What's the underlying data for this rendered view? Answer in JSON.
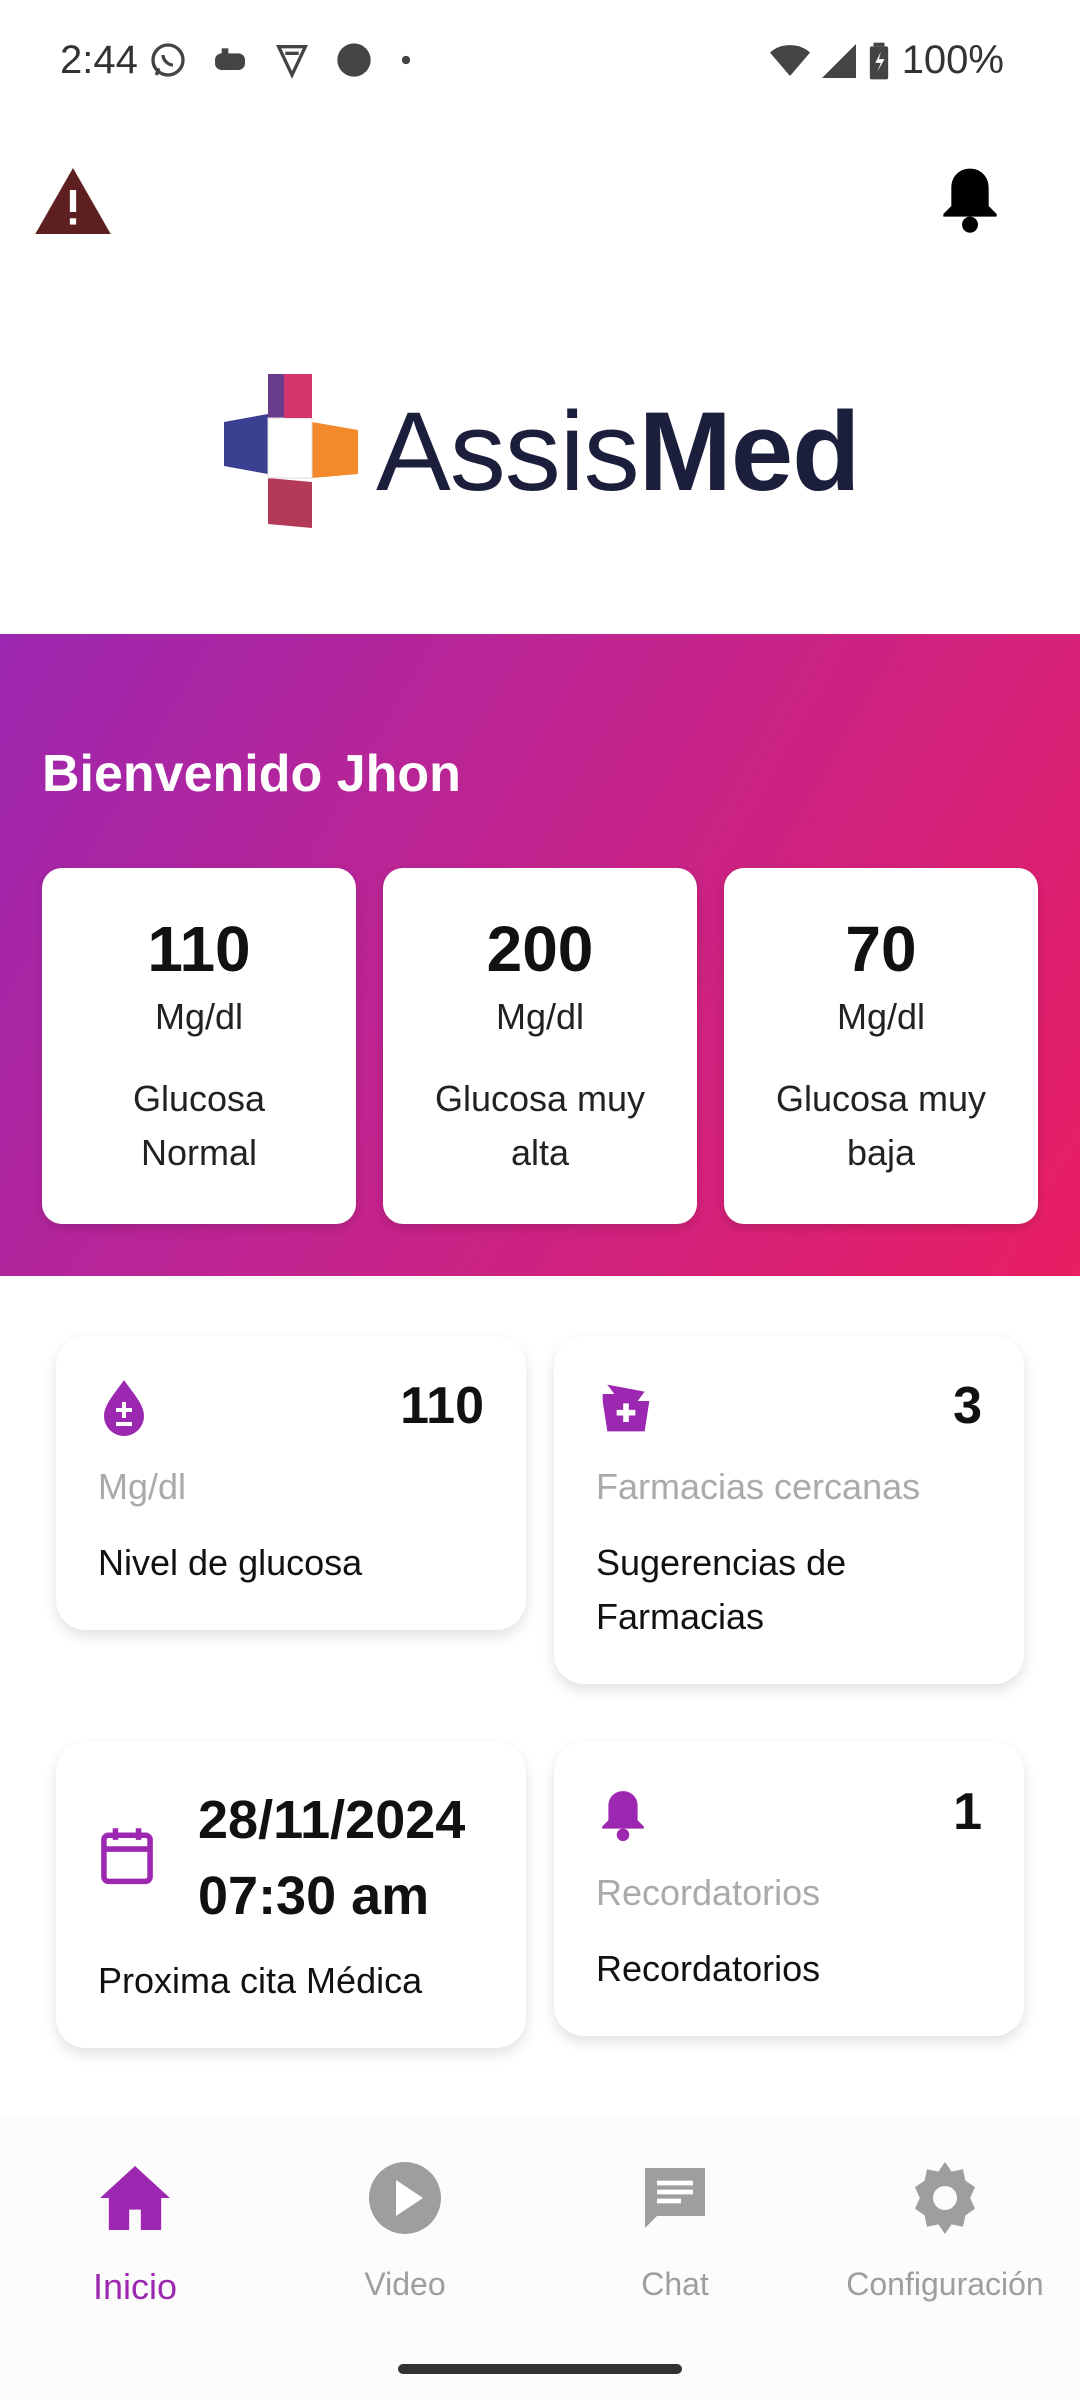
{
  "status_bar": {
    "time": "2:44",
    "battery": "100%"
  },
  "brand": {
    "name_light": "Assis",
    "name_bold": "Med",
    "accent": "#9c27b0",
    "gradient_end": "#e91e63"
  },
  "hero": {
    "welcome": "Bienvenido Jhon",
    "cards": [
      {
        "value": "110",
        "unit": "Mg/dl",
        "label": "Glucosa Normal"
      },
      {
        "value": "200",
        "unit": "Mg/dl",
        "label": "Glucosa muy alta"
      },
      {
        "value": "70",
        "unit": "Mg/dl",
        "label": "Glucosa muy baja"
      }
    ]
  },
  "cards": {
    "glucose": {
      "icon": "glucose-drop-icon",
      "value": "110",
      "sub": "Mg/dl",
      "label": "Nivel de glucosa"
    },
    "pharmacies": {
      "icon": "pharmacy-icon",
      "value": "3",
      "sub": "Farmacias cercanas",
      "label": "Sugerencias de Farmacias"
    },
    "appointment": {
      "icon": "calendar-icon",
      "date": "28/11/2024",
      "time": "07:30 am",
      "label": "Proxima cita Médica"
    },
    "reminders": {
      "icon": "bell-icon",
      "value": "1",
      "sub": "Recordatorios",
      "label": "Recordatorios"
    }
  },
  "nav": {
    "items": [
      {
        "label": "Inicio",
        "icon": "home-icon",
        "active": true
      },
      {
        "label": "Video",
        "icon": "play-icon",
        "active": false
      },
      {
        "label": "Chat",
        "icon": "chat-icon",
        "active": false
      },
      {
        "label": "Configuración",
        "icon": "gear-icon",
        "active": false
      }
    ]
  }
}
